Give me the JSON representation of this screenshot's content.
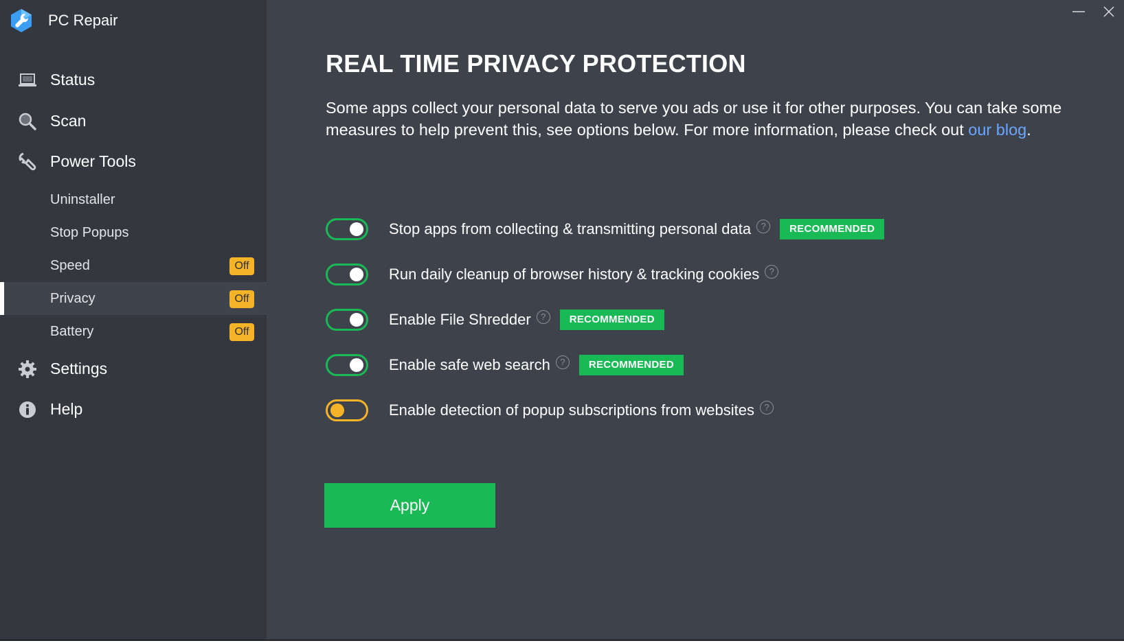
{
  "app": {
    "name": "PC Repair"
  },
  "window_controls": {
    "minimize_icon": "minimize-icon",
    "close_icon": "close-icon"
  },
  "sidebar": {
    "main_items": [
      {
        "label": "Status",
        "icon": "laptop-icon"
      },
      {
        "label": "Scan",
        "icon": "magnifier-icon"
      },
      {
        "label": "Power Tools",
        "icon": "wrench-icon"
      },
      {
        "label": "Settings",
        "icon": "gear-icon"
      },
      {
        "label": "Help",
        "icon": "info-icon"
      }
    ],
    "sub_items": [
      {
        "label": "Uninstaller",
        "badge": ""
      },
      {
        "label": "Stop Popups",
        "badge": ""
      },
      {
        "label": "Speed",
        "badge": "Off"
      },
      {
        "label": "Privacy",
        "badge": "Off",
        "active": true
      },
      {
        "label": "Battery",
        "badge": "Off"
      }
    ]
  },
  "main": {
    "title": "REAL TIME PRIVACY PROTECTION",
    "description": "Some apps collect your personal data to serve you ads or use it for other purposes. You can take some measures to help prevent this, see options below. For more information, please check out ",
    "link_text": "our blog",
    "description_end": ".",
    "options": [
      {
        "label": "Stop apps from collecting & transmitting personal data",
        "enabled": true,
        "badge": "RECOMMENDED"
      },
      {
        "label": "Run daily cleanup of browser history & tracking cookies",
        "enabled": true,
        "badge": ""
      },
      {
        "label": "Enable File Shredder",
        "enabled": true,
        "badge": "RECOMMENDED"
      },
      {
        "label": "Enable safe web search",
        "enabled": true,
        "badge": "RECOMMENDED"
      },
      {
        "label": "Enable detection of popup subscriptions from websites",
        "enabled": false,
        "badge": ""
      }
    ],
    "help_glyph": "?",
    "apply_label": "Apply"
  },
  "colors": {
    "green": "#19b955",
    "orange": "#f5b428",
    "link": "#6aa6ff",
    "sidebar_bg": "#34373e",
    "content_bg": "#3e424b"
  }
}
